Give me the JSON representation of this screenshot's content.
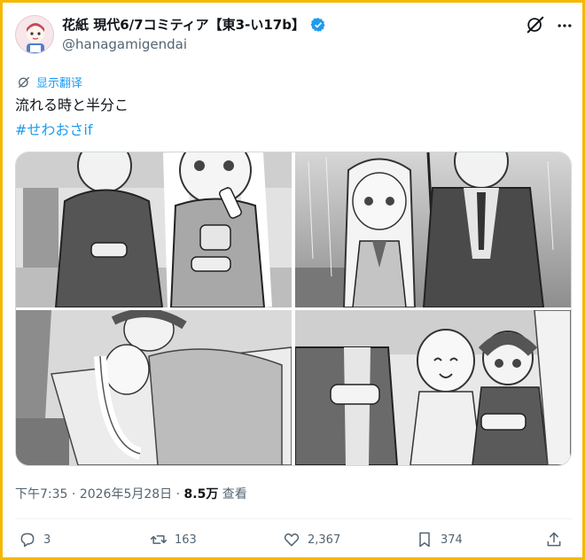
{
  "author": {
    "display_name": "花紙 現代6/7コミティア【東3-い17b】",
    "handle": "@hanagamigendai",
    "verified": true
  },
  "translate_label": "显示翻译",
  "tweet": {
    "text": "流れる時と半分こ",
    "hashtag": "#せわおさif"
  },
  "meta": {
    "time": "下午7:35",
    "sep1": " · ",
    "date": "2026年5月28日",
    "sep2": " · ",
    "views": "8.5万",
    "views_label": " 查看"
  },
  "actions": {
    "replies": "3",
    "reposts": "163",
    "likes": "2,367",
    "bookmarks": "374"
  },
  "icons": {
    "verified": "verified-badge-icon",
    "grok": "grok-icon",
    "more": "more-options-icon",
    "reply": "reply-icon",
    "repost": "repost-icon",
    "like": "heart-icon",
    "bookmark": "bookmark-icon",
    "share": "share-icon"
  },
  "colors": {
    "accent": "#1d9bf0",
    "frame": "#f5b800",
    "muted": "#536471"
  }
}
